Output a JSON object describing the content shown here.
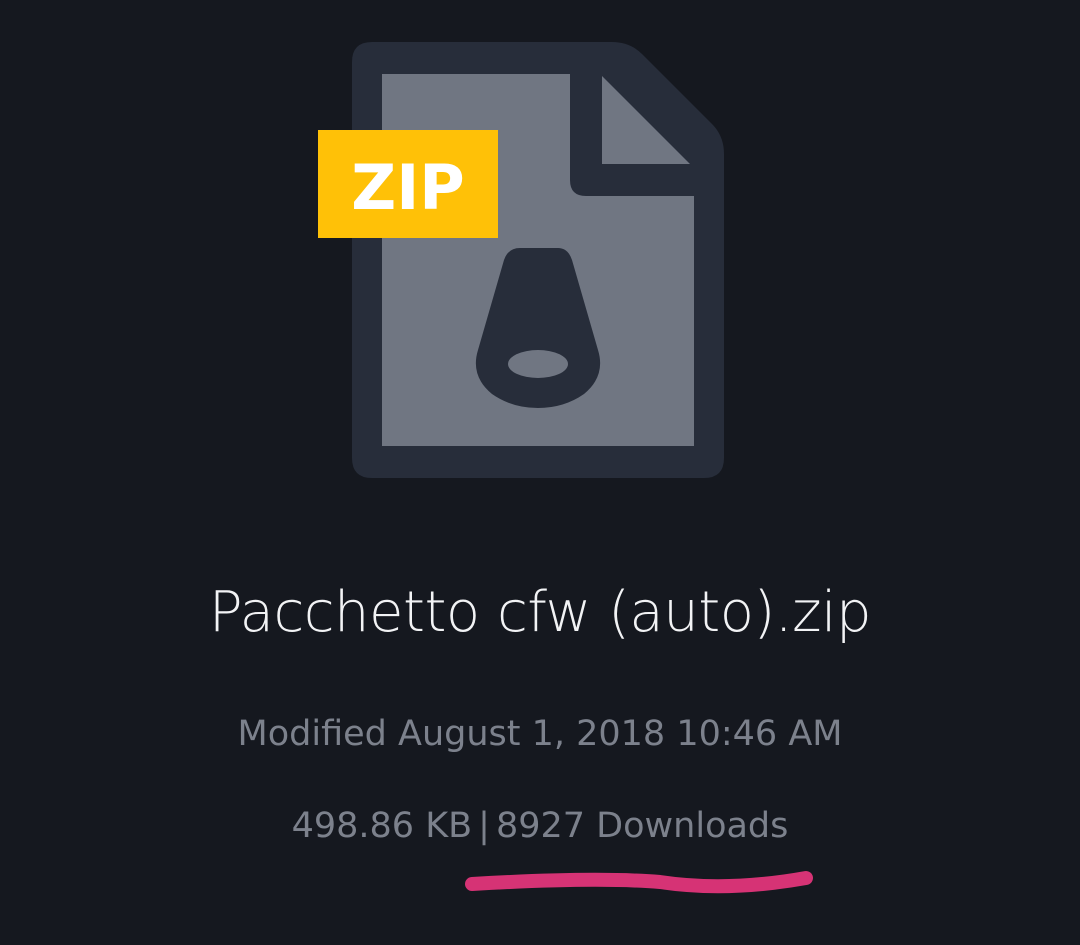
{
  "file": {
    "badge_label": "ZIP",
    "icon": "zip-file-icon",
    "name": "Pacchetto cfw (auto).zip",
    "modified": "Modified August 1, 2018 10:46 AM",
    "size": "498.86 KB",
    "separator": "|",
    "downloads": "8927 Downloads"
  },
  "colors": {
    "background": "#15181f",
    "icon_dark": "#272d3a",
    "icon_light": "#707682",
    "badge": "#ffc107",
    "annotation": "#d63375"
  }
}
